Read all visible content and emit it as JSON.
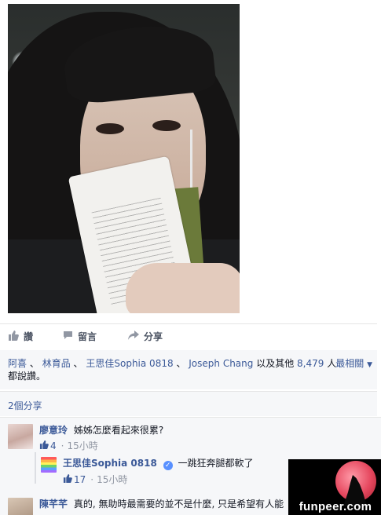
{
  "post": {
    "photo_alt": ""
  },
  "actions": {
    "like_label": "讚",
    "comment_label": "留言",
    "share_label": "分享"
  },
  "likes": {
    "people": [
      "阿喜",
      "林育品",
      "王思佳Sophia 0818"
    ],
    "sep1": "、",
    "sep2": "、",
    "sep3": " 、 ",
    "person4": "Joseph Chang",
    "others_prefix": " 以及其他 ",
    "others_count": "8,479",
    "others_suffix": " 人",
    "line2": "都說讚。",
    "sort_label": "最相關"
  },
  "shares": {
    "label": "2個分享"
  },
  "comments": [
    {
      "name": "廖意玲",
      "text": "姊姊怎麼看起來很累?",
      "likes": "4",
      "time": "15小時"
    },
    {
      "name": "王思佳Sophia 0818",
      "text": "一跳狂奔腿都軟了",
      "likes": "17",
      "time": "15小時"
    },
    {
      "name": "陳芊芊",
      "text": "真的, 無助時最需要的並不是什麼, 只是希望有人能"
    }
  ],
  "watermark": {
    "text": "funpeer.com"
  },
  "colors": {
    "link": "#3b5998",
    "muted": "#9197a3",
    "bar_bg": "#f6f7f9"
  }
}
